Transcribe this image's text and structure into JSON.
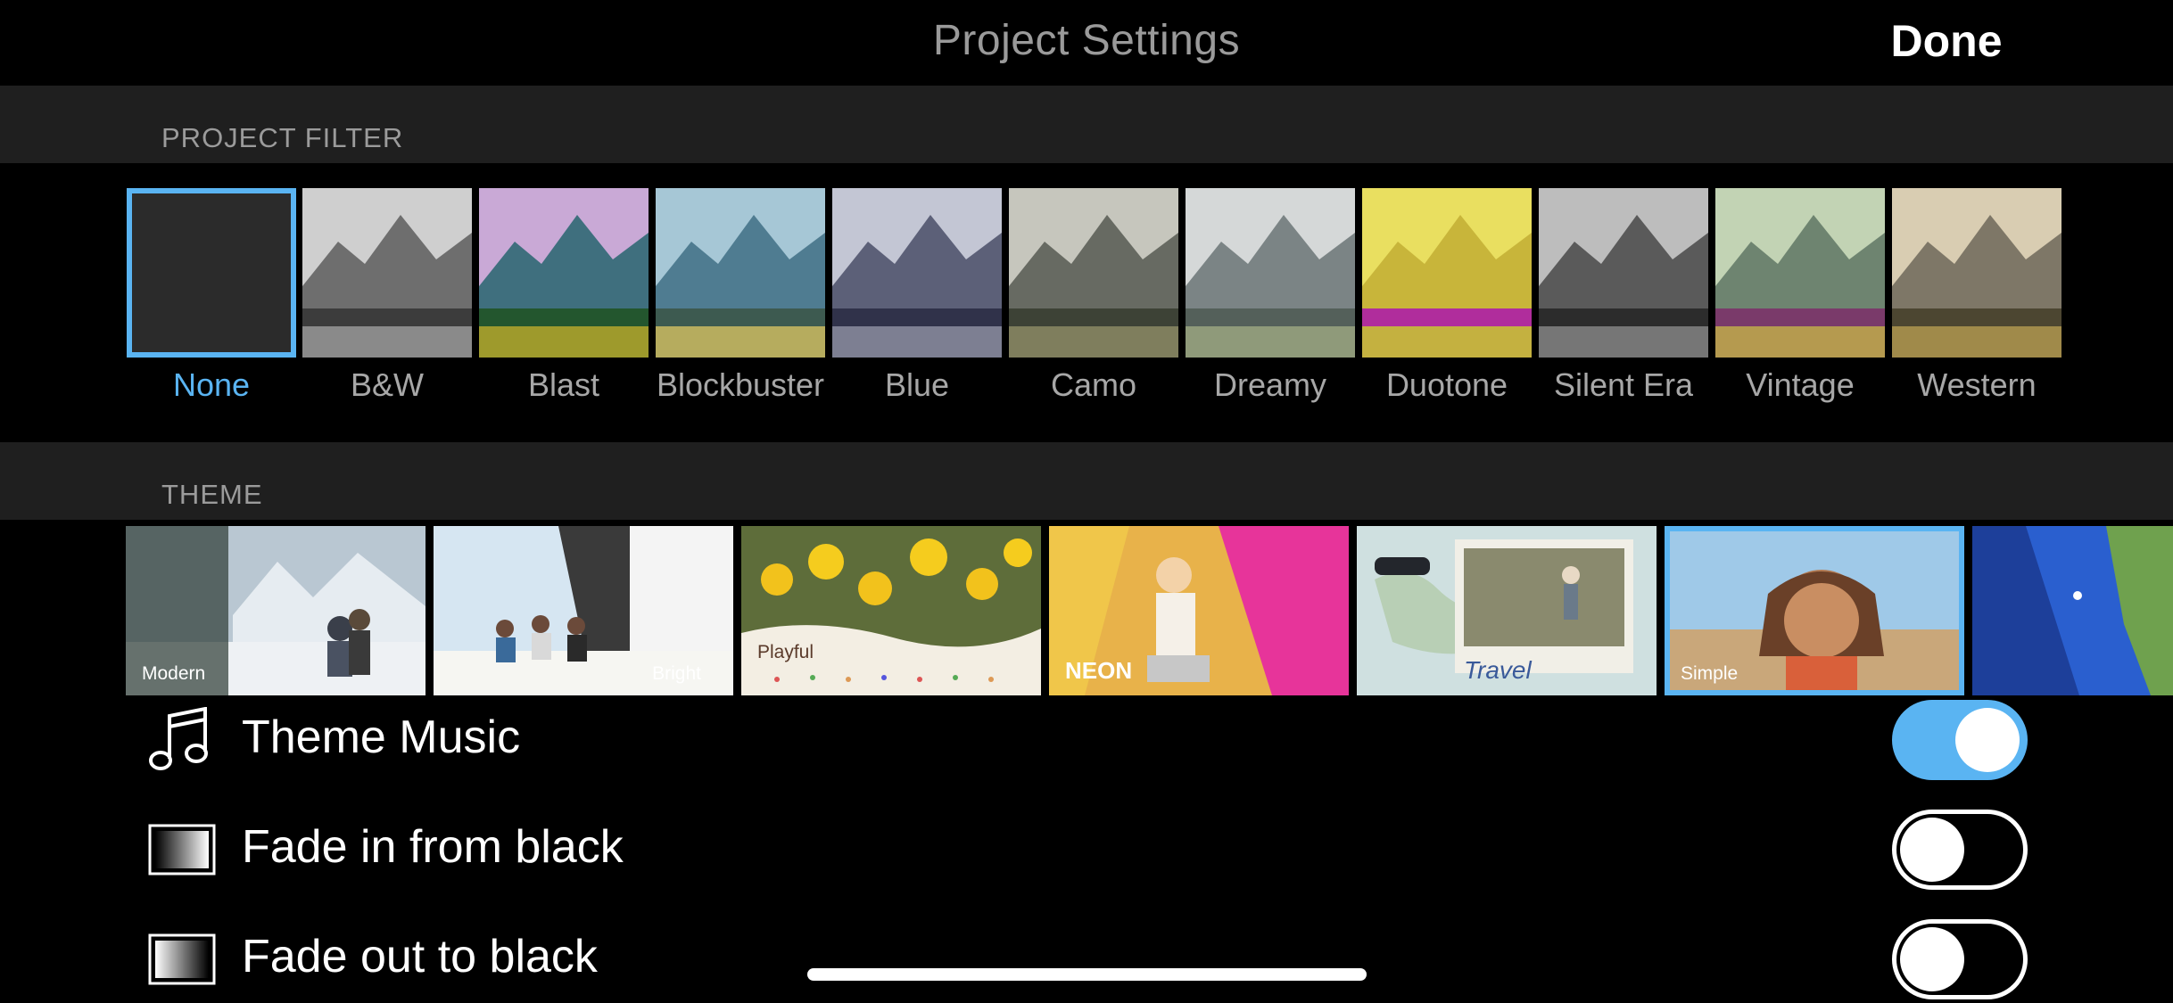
{
  "nav": {
    "title": "Project Settings",
    "done_label": "Done"
  },
  "sections": {
    "filter_header": "PROJECT FILTER",
    "theme_header": "THEME"
  },
  "filters": [
    {
      "label": "None"
    },
    {
      "label": "B&W"
    },
    {
      "label": "Blast"
    },
    {
      "label": "Blockbuster"
    },
    {
      "label": "Blue"
    },
    {
      "label": "Camo"
    },
    {
      "label": "Dreamy"
    },
    {
      "label": "Duotone"
    },
    {
      "label": "Silent Era"
    },
    {
      "label": "Vintage"
    },
    {
      "label": "Western"
    }
  ],
  "selected_filter": "None",
  "themes": [
    {
      "label": "Modern"
    },
    {
      "label": "Bright"
    },
    {
      "label": "Playful"
    },
    {
      "label": "NEON"
    },
    {
      "label": "Travel"
    },
    {
      "label": "Simple"
    },
    {
      "label": ""
    }
  ],
  "selected_theme": "Simple",
  "settings": [
    {
      "label": "Theme Music",
      "icon": "music-note-icon",
      "enabled": true
    },
    {
      "label": "Fade in from black",
      "icon": "fade-in-icon",
      "enabled": false
    },
    {
      "label": "Fade out to black",
      "icon": "fade-out-icon",
      "enabled": false
    }
  ],
  "colors": {
    "accent": "#5ab4f2",
    "section_bg": "#1f1f1f",
    "muted_text": "#a7a7a7"
  }
}
